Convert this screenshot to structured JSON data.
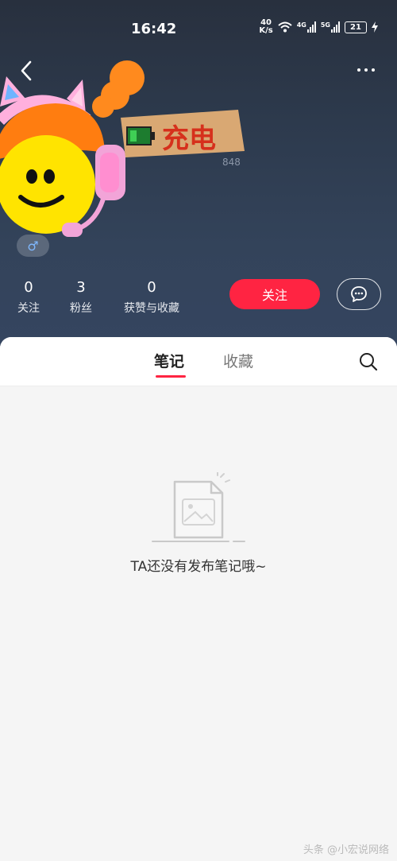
{
  "status_bar": {
    "time": "16:42",
    "net_speed_value": "40",
    "net_speed_unit": "K/s",
    "signal1_label": "4G",
    "signal2_label": "5G",
    "battery_level": "21"
  },
  "profile": {
    "uid_fragment": "848",
    "sign_text": "充电",
    "gender_symbol": "♂"
  },
  "stats": [
    {
      "value": "0",
      "label": "关注"
    },
    {
      "value": "3",
      "label": "粉丝"
    },
    {
      "value": "0",
      "label": "获赞与收藏"
    }
  ],
  "actions": {
    "follow_label": "关注"
  },
  "tabs": {
    "notes_label": "笔记",
    "collections_label": "收藏"
  },
  "empty_state": {
    "message": "TA还没有发布笔记哦~"
  },
  "watermark": "头条 @小宏说网络",
  "colors": {
    "accent": "#ff2442",
    "header_bg": "#2d3a4d",
    "content_bg": "#f5f5f5"
  }
}
